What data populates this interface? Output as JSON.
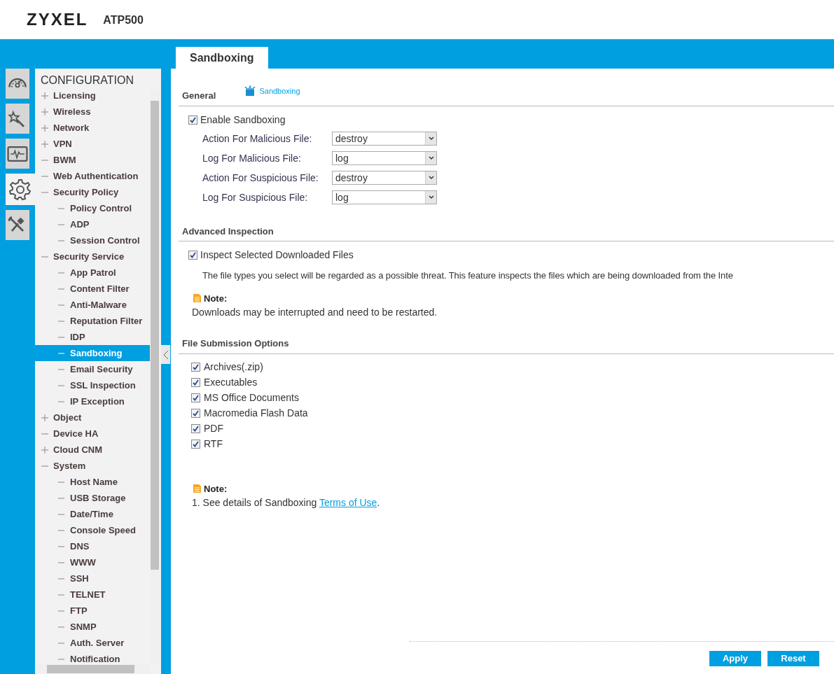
{
  "header": {
    "brand": "ZYXEL",
    "model": "ATP500"
  },
  "side_icons": [
    {
      "kind": "dashboard",
      "selected": false
    },
    {
      "kind": "wizard",
      "selected": false
    },
    {
      "kind": "monitor",
      "selected": false
    },
    {
      "kind": "configuration",
      "selected": true
    },
    {
      "kind": "maintenance",
      "selected": false
    }
  ],
  "nav": {
    "title": "CONFIGURATION",
    "items": [
      {
        "label": "Licensing",
        "expanded": false,
        "selected": false
      },
      {
        "label": "Wireless",
        "expanded": false,
        "selected": false
      },
      {
        "label": "Network",
        "expanded": false,
        "selected": false
      },
      {
        "label": "VPN",
        "expanded": false,
        "selected": false
      },
      {
        "label": "BWM",
        "expanded": true,
        "selected": false
      },
      {
        "label": "Web Authentication",
        "expanded": true,
        "selected": false
      },
      {
        "label": "Security Policy",
        "expanded": true,
        "selected": false,
        "children": [
          {
            "label": "Policy Control",
            "selected": false
          },
          {
            "label": "ADP",
            "selected": false
          },
          {
            "label": "Session Control",
            "selected": false
          }
        ]
      },
      {
        "label": "Security Service",
        "expanded": true,
        "selected": false,
        "children": [
          {
            "label": "App Patrol",
            "selected": false
          },
          {
            "label": "Content Filter",
            "selected": false
          },
          {
            "label": "Anti-Malware",
            "selected": false
          },
          {
            "label": "Reputation Filter",
            "selected": false
          },
          {
            "label": "IDP",
            "selected": false
          },
          {
            "label": "Sandboxing",
            "selected": true
          },
          {
            "label": "Email Security",
            "selected": false
          },
          {
            "label": "SSL Inspection",
            "selected": false
          },
          {
            "label": "IP Exception",
            "selected": false
          }
        ]
      },
      {
        "label": "Object",
        "expanded": false,
        "selected": false
      },
      {
        "label": "Device HA",
        "expanded": true,
        "selected": false
      },
      {
        "label": "Cloud CNM",
        "expanded": false,
        "selected": false
      },
      {
        "label": "System",
        "expanded": true,
        "selected": false,
        "children": [
          {
            "label": "Host Name",
            "selected": false
          },
          {
            "label": "USB Storage",
            "selected": false
          },
          {
            "label": "Date/Time",
            "selected": false
          },
          {
            "label": "Console Speed",
            "selected": false
          },
          {
            "label": "DNS",
            "selected": false
          },
          {
            "label": "WWW",
            "selected": false
          },
          {
            "label": "SSH",
            "selected": false
          },
          {
            "label": "TELNET",
            "selected": false
          },
          {
            "label": "FTP",
            "selected": false
          },
          {
            "label": "SNMP",
            "selected": false
          },
          {
            "label": "Auth. Server",
            "selected": false
          },
          {
            "label": "Notification",
            "selected": false
          }
        ]
      }
    ]
  },
  "tabs": [
    {
      "label": "Sandboxing",
      "selected": true
    }
  ],
  "general": {
    "title": "General",
    "link": "Sandboxing",
    "enable": {
      "label": "Enable Sandboxing",
      "checked": true
    },
    "fields": [
      {
        "label": "Action For Malicious File:",
        "value": "destroy"
      },
      {
        "label": "Log For Malicious File:",
        "value": "log"
      },
      {
        "label": "Action For Suspicious File:",
        "value": "destroy"
      },
      {
        "label": "Log For Suspicious File:",
        "value": "log"
      }
    ]
  },
  "advanced": {
    "title": "Advanced Inspection",
    "inspect": {
      "label": "Inspect Selected Downloaded Files",
      "checked": true
    },
    "description": "The file types you select will be regarded as a possible threat. This feature inspects the files which are being downloaded from the Inte",
    "note_title": "Note:",
    "note": "Downloads may be interrupted and need to be restarted."
  },
  "submission": {
    "title": "File Submission Options",
    "options": [
      {
        "label": "Archives(.zip)",
        "checked": true
      },
      {
        "label": "Executables",
        "checked": true
      },
      {
        "label": "MS Office Documents",
        "checked": true
      },
      {
        "label": "Macromedia Flash Data",
        "checked": true
      },
      {
        "label": "PDF",
        "checked": true
      },
      {
        "label": "RTF",
        "checked": true
      }
    ]
  },
  "footer_note": {
    "title": "Note:",
    "text": "1. See details of Sandboxing ",
    "link": "Terms of Use",
    "after": "."
  },
  "buttons": [
    "Apply",
    "Reset"
  ]
}
